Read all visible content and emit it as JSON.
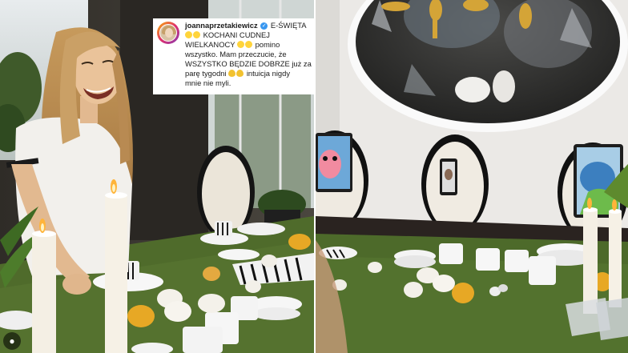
{
  "caption": {
    "username": "joannaprzetakiewicz",
    "verified_icon": "verified-check-icon",
    "lines": [
      "E-ŚWIĘTA",
      "KOCHANI CUDNEJ",
      "WIELKANOCY",
      "pomino",
      "wszystko. Mam przeczucie, że",
      "WSZYSTKO BĘDZIE DOBRZE już za",
      "parę tygodni",
      "intuicja nigdy",
      "mnie nie myli."
    ]
  },
  "icons": {
    "tagged_user": "user-tag-icon"
  },
  "colors": {
    "grass": "#4f6b2b",
    "candle": "#f4efe4",
    "flame": "#ffb43a",
    "egg_yellow": "#e7a825"
  }
}
